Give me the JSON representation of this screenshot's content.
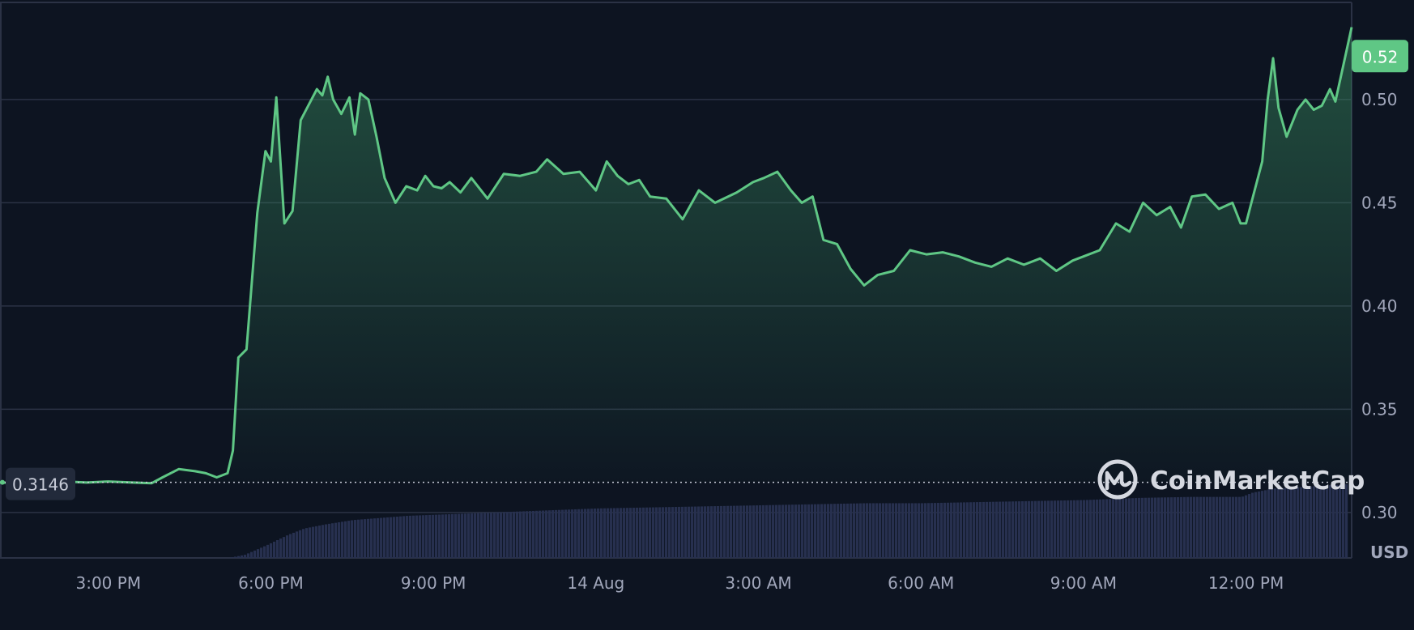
{
  "brand": {
    "name": "CoinMarketCap"
  },
  "colors": {
    "background": "#0d1421",
    "grid": "#2b3245",
    "up_line": "#5fc785",
    "down_line": "#ea3943",
    "volume": "#27304f",
    "badge": "#5fc785",
    "start_badge": "#222a3b"
  },
  "chart_data": {
    "type": "area",
    "ylim": [
      0.278,
      0.547
    ],
    "y_ticks": [
      0.3,
      0.35,
      0.4,
      0.45,
      0.5
    ],
    "y_tick_labels": [
      "0.30",
      "0.35",
      "0.40",
      "0.45",
      "0.50"
    ],
    "x_tick_labels": [
      "3:00 PM",
      "6:00 PM",
      "9:00 PM",
      "14 Aug",
      "3:00 AM",
      "6:00 AM",
      "9:00 AM",
      "12:00 PM"
    ],
    "x_range_hours": [
      13.0,
      37.95
    ],
    "x_ticks_hours": [
      15,
      18,
      21,
      24,
      27,
      30,
      33,
      36
    ],
    "unit": "USD",
    "current_price_label": "0.52",
    "current_price": 0.521,
    "start_price_label": "0.3146",
    "start_price": 0.3146,
    "grid": true,
    "price_hours": [
      13.0,
      13.4,
      13.8,
      14.2,
      14.6,
      15.0,
      15.4,
      15.8,
      16.0,
      16.3,
      16.6,
      16.8,
      17.0,
      17.1,
      17.2,
      17.3,
      17.4,
      17.55,
      17.75,
      17.9,
      18.0,
      18.1,
      18.25,
      18.4,
      18.55,
      18.75,
      18.85,
      18.95,
      19.05,
      19.15,
      19.3,
      19.45,
      19.55,
      19.65,
      19.8,
      19.95,
      20.1,
      20.3,
      20.5,
      20.7,
      20.85,
      21.0,
      21.15,
      21.3,
      21.5,
      21.7,
      22.0,
      22.3,
      22.6,
      22.9,
      23.1,
      23.4,
      23.7,
      24.0,
      24.2,
      24.4,
      24.6,
      24.8,
      25.0,
      25.3,
      25.6,
      25.9,
      26.2,
      26.6,
      26.9,
      27.1,
      27.35,
      27.6,
      27.8,
      28.0,
      28.2,
      28.45,
      28.7,
      28.95,
      29.2,
      29.5,
      29.8,
      30.1,
      30.4,
      30.7,
      31.0,
      31.3,
      31.6,
      31.9,
      32.2,
      32.5,
      32.8,
      33.0,
      33.3,
      33.6,
      33.85,
      34.1,
      34.35,
      34.6,
      34.8,
      35.0,
      35.25,
      35.5,
      35.75,
      35.9,
      36.0,
      36.1,
      36.2,
      36.3,
      36.4,
      36.5,
      36.6,
      36.75,
      36.95,
      37.1,
      37.25,
      37.4,
      37.55,
      37.65,
      37.8,
      37.95
    ],
    "price_values": [
      0.3146,
      0.314,
      0.3145,
      0.315,
      0.3145,
      0.315,
      0.3146,
      0.3142,
      0.317,
      0.321,
      0.32,
      0.319,
      0.317,
      0.318,
      0.319,
      0.33,
      0.375,
      0.379,
      0.445,
      0.475,
      0.47,
      0.501,
      0.44,
      0.446,
      0.49,
      0.5,
      0.505,
      0.502,
      0.511,
      0.5,
      0.493,
      0.501,
      0.483,
      0.503,
      0.5,
      0.482,
      0.462,
      0.45,
      0.458,
      0.456,
      0.463,
      0.458,
      0.457,
      0.46,
      0.455,
      0.462,
      0.452,
      0.464,
      0.463,
      0.465,
      0.471,
      0.464,
      0.465,
      0.456,
      0.47,
      0.463,
      0.459,
      0.461,
      0.453,
      0.452,
      0.442,
      0.456,
      0.45,
      0.455,
      0.46,
      0.462,
      0.465,
      0.456,
      0.45,
      0.453,
      0.432,
      0.43,
      0.418,
      0.41,
      0.415,
      0.417,
      0.427,
      0.425,
      0.426,
      0.424,
      0.421,
      0.419,
      0.423,
      0.42,
      0.423,
      0.417,
      0.422,
      0.424,
      0.427,
      0.44,
      0.436,
      0.45,
      0.444,
      0.448,
      0.438,
      0.453,
      0.454,
      0.447,
      0.45,
      0.44,
      0.44,
      0.45,
      0.46,
      0.47,
      0.5,
      0.52,
      0.496,
      0.482,
      0.495,
      0.5,
      0.495,
      0.497,
      0.505,
      0.499,
      0.517,
      0.535,
      0.523,
      0.521
    ],
    "volume_hours": [
      17.2,
      17.5,
      17.9,
      18.3,
      18.6,
      19.0,
      19.5,
      20.0,
      20.5,
      21.0,
      22.0,
      23.0,
      24.0,
      25.0,
      26.0,
      27.0,
      28.0,
      29.0,
      30.0,
      31.0,
      32.0,
      33.0,
      34.0,
      35.0,
      35.9,
      36.1,
      36.5,
      36.9,
      37.2,
      37.5,
      37.85
    ],
    "volume_values": [
      0,
      0.03,
      0.12,
      0.22,
      0.28,
      0.32,
      0.36,
      0.38,
      0.4,
      0.41,
      0.43,
      0.45,
      0.47,
      0.48,
      0.49,
      0.5,
      0.51,
      0.52,
      0.52,
      0.53,
      0.54,
      0.55,
      0.57,
      0.58,
      0.58,
      0.62,
      0.66,
      0.67,
      0.68,
      0.69,
      0.7
    ]
  }
}
